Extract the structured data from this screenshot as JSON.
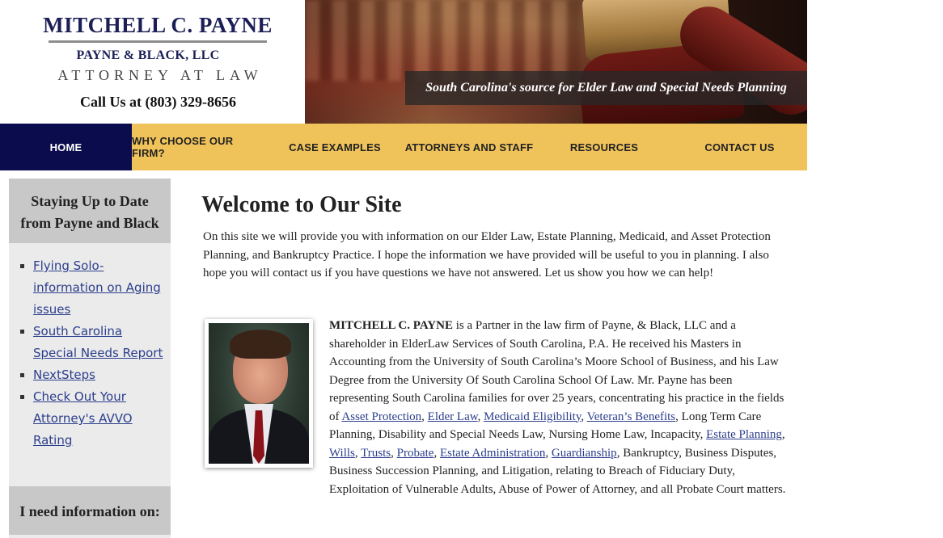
{
  "header": {
    "firm_name": "MITCHELL C. PAYNE",
    "firm_llc": "PAYNE & BLACK, LLC",
    "tagline": "ATTORNEY AT LAW",
    "phone": "Call Us at (803) 329-8656",
    "banner_caption": "South Carolina's source for Elder Law and Special Needs Planning"
  },
  "nav": {
    "items": [
      {
        "label": "HOME",
        "active": true
      },
      {
        "label": "WHY CHOOSE OUR FIRM?"
      },
      {
        "label": "CASE EXAMPLES"
      },
      {
        "label": "ATTORNEYS AND STAFF"
      },
      {
        "label": "RESOURCES"
      },
      {
        "label": "CONTACT US"
      }
    ]
  },
  "sidebar": {
    "heading1_line1": "Staying Up to Date",
    "heading1_line2": "from Payne and Black",
    "links": [
      {
        "label_l1": "Flying Solo-",
        "label_l2": "information on Aging",
        "label_l3": "issues"
      },
      {
        "label_l1": "South Carolina",
        "label_l2": "Special Needs Report"
      },
      {
        "label_l1": "NextSteps"
      },
      {
        "label_l1": "Check Out Your",
        "label_l2": "Attorney's AVVO",
        "label_l3": "Rating"
      }
    ],
    "heading2": "I need information on:"
  },
  "main": {
    "title": "Welcome to Our Site",
    "intro": "On this site we will provide you with information on our Elder Law, Estate Planning, Medicaid, and Asset Protection Planning, and Bankruptcy Practice.  I hope the information we have provided will be useful to  you in planning.  I also hope you will contact us if you have questions we have not answered.  Let us show you how we can help!",
    "photo_alt": "Mitchell C. Payne",
    "bio": {
      "name": "MITCHELL C. PAYNE",
      "text1": " is a Partner in the law firm of Payne, & Black, LLC and a shareholder in ElderLaw Services of South Carolina, P.A. He received his Masters in Accounting from the University of South Carolina’s Moore School of Business, and his Law Degree from the University Of South Carolina School Of Law. Mr. Payne has been representing South Carolina families for over 25 years, concentrating his practice in the fields of ",
      "link_asset_protection": "Asset Protection",
      "link_elder_law": "Elder Law",
      "link_medicaid": "Medicaid Eligibility",
      "link_veterans": "Veteran’s Benefits",
      "text2": ", Long Term Care Planning, Disability and Special Needs Law, Nursing Home Law, Incapacity, ",
      "link_estate_planning": "Estate Planning",
      "link_wills": "Wills",
      "link_trusts": "Trusts",
      "link_probate": "Probate",
      "link_estate_admin": "Estate Administration",
      "link_guardianship": "Guardianship",
      "text3": ", Bankruptcy, Business Disputes, Business Succession Planning, and Litigation, relating to Breach of Fiduciary Duty, Exploitation of Vulnerable Adults, Abuse of Power of Attorney, and all Probate Court matters.",
      "sep": ", "
    }
  },
  "colors": {
    "nav_bg": "#f0c35a",
    "nav_active": "#0a0c4e",
    "brand_navy": "#1c1f56",
    "link": "#2b3e8c",
    "sidebar_bg": "#ebebeb",
    "sidebar_head": "#c8c8c8"
  }
}
